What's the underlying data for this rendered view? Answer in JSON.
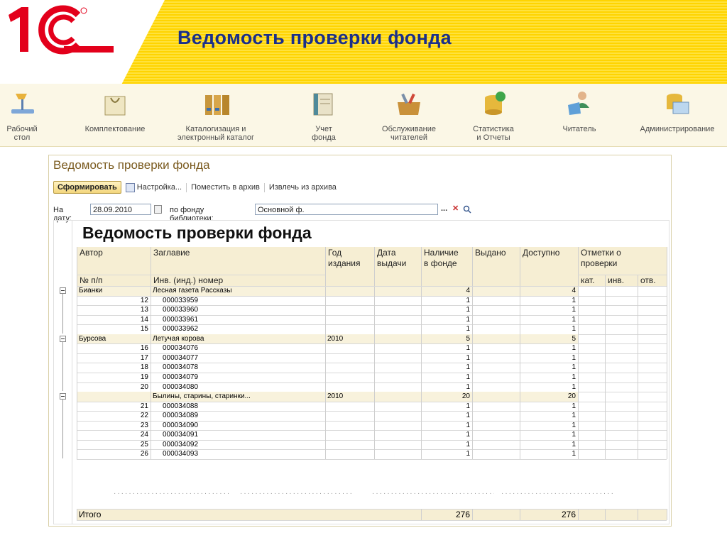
{
  "banner": {
    "title": "Ведомость проверки фонда"
  },
  "sections": [
    {
      "label": "Рабочий\nстол",
      "icon": "desk-lamp-icon"
    },
    {
      "label": "Комплектование",
      "icon": "shopping-bag-icon"
    },
    {
      "label": "Каталогизация и\nэлектронный каталог",
      "icon": "catalog-binders-icon"
    },
    {
      "label": "Учет\nфонда",
      "icon": "ledger-book-icon"
    },
    {
      "label": "Обслуживание\nчитателей",
      "icon": "toolbox-icon"
    },
    {
      "label": "Статистика\nи Отчеты",
      "icon": "database-sync-icon"
    },
    {
      "label": "Читатель",
      "icon": "user-laptop-icon"
    },
    {
      "label": "Администрирование",
      "icon": "admin-server-icon"
    }
  ],
  "form": {
    "title": "Ведомость проверки фонда",
    "toolbar": {
      "generate": "Сформировать",
      "settings": "Настройка...",
      "archive": "Поместить в архив",
      "extract": "Извлечь из архива"
    },
    "params": {
      "date_label": "На дату:",
      "date_value": "28.09.2010",
      "fund_label": "по фонду библиотеки:",
      "fund_value": "Основной ф.",
      "btn_select": "...",
      "btn_clear": "✕"
    }
  },
  "report": {
    "title": "Ведомость проверки фонда",
    "headers": {
      "author": "Автор",
      "title": "Заглавие",
      "year": "Год\nиздания",
      "date_issue": "Дата\nвыдачи",
      "available_fund": "Наличие\nв фонде",
      "issued": "Выдано",
      "accessible": "Доступно",
      "marks": "Отметки о\nпроверки",
      "num": "№ п/п",
      "inv": "Инв. (инд.) номер",
      "cat": "кат.",
      "invm": "инв.",
      "otv": "отв."
    },
    "rows": [
      {
        "type": "group",
        "author": "Бианки",
        "title": "Лесная газета Рассказы",
        "year": "",
        "in_fund": "4",
        "available": "4"
      },
      {
        "type": "item",
        "num": "12",
        "inv": "000033959",
        "in_fund": "1",
        "available": "1"
      },
      {
        "type": "item",
        "num": "13",
        "inv": "000033960",
        "in_fund": "1",
        "available": "1"
      },
      {
        "type": "item",
        "num": "14",
        "inv": "000033961",
        "in_fund": "1",
        "available": "1"
      },
      {
        "type": "item",
        "num": "15",
        "inv": "000033962",
        "in_fund": "1",
        "available": "1"
      },
      {
        "type": "group",
        "author": "Бурсова",
        "title": "Летучая корова",
        "year": "2010",
        "in_fund": "5",
        "available": "5"
      },
      {
        "type": "item",
        "num": "16",
        "inv": "000034076",
        "in_fund": "1",
        "available": "1"
      },
      {
        "type": "item",
        "num": "17",
        "inv": "000034077",
        "in_fund": "1",
        "available": "1"
      },
      {
        "type": "item",
        "num": "18",
        "inv": "000034078",
        "in_fund": "1",
        "available": "1"
      },
      {
        "type": "item",
        "num": "19",
        "inv": "000034079",
        "in_fund": "1",
        "available": "1"
      },
      {
        "type": "item",
        "num": "20",
        "inv": "000034080",
        "in_fund": "1",
        "available": "1"
      },
      {
        "type": "group",
        "author": "",
        "title": "Былины, старины, старинки...",
        "year": "2010",
        "in_fund": "20",
        "available": "20"
      },
      {
        "type": "item",
        "num": "21",
        "inv": "000034088",
        "in_fund": "1",
        "available": "1"
      },
      {
        "type": "item",
        "num": "22",
        "inv": "000034089",
        "in_fund": "1",
        "available": "1"
      },
      {
        "type": "item",
        "num": "23",
        "inv": "000034090",
        "in_fund": "1",
        "available": "1"
      },
      {
        "type": "item",
        "num": "24",
        "inv": "000034091",
        "in_fund": "1",
        "available": "1"
      },
      {
        "type": "item",
        "num": "25",
        "inv": "000034092",
        "in_fund": "1",
        "available": "1"
      },
      {
        "type": "item",
        "num": "26",
        "inv": "000034093",
        "in_fund": "1",
        "available": "1"
      }
    ],
    "total": {
      "label": "Итого",
      "in_fund": "276",
      "available": "276"
    }
  }
}
